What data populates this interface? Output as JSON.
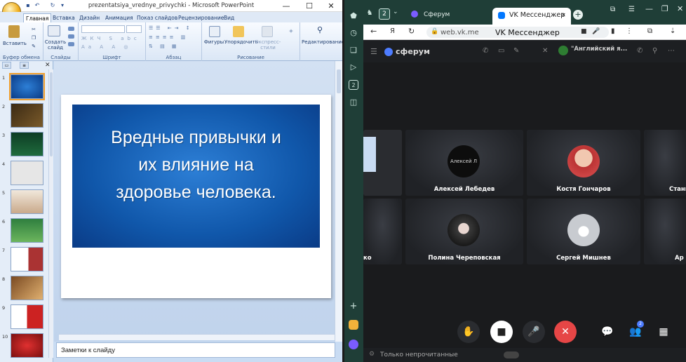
{
  "ppt": {
    "doc_title": "prezentatsiya_vrednye_privychki - Microsoft PowerPoint",
    "tabs": [
      "Главная",
      "Вставка",
      "Дизайн",
      "Анимация",
      "Показ слайдов",
      "Рецензирование",
      "Вид"
    ],
    "ribbon": {
      "paste_label": "Вставить",
      "new_slide_label": "Создать слайд",
      "shapes_label": "Фигуры",
      "arrange_label": "Упорядочить",
      "express_label": "Экспресс-стили",
      "edit_label": "Редактирование",
      "groups": {
        "clipboard": "Буфер обмена",
        "slides": "Слайды",
        "font": "Шрифт",
        "paragraph": "Абзац",
        "drawing": "Рисование"
      }
    },
    "thumbnails": [
      "1",
      "2",
      "3",
      "4",
      "5",
      "6",
      "7",
      "8",
      "9",
      "10"
    ],
    "slide_title": "Вредные привычки и их влияние на здоровье человека.",
    "slide_lines": [
      "Вредные привычки и",
      "их влияние на",
      "здоровье человека."
    ],
    "notes_placeholder": "Заметки к слайду"
  },
  "browser": {
    "tab_count_badge": "2",
    "tabs": [
      {
        "label": "Сферум"
      },
      {
        "label": "VK Мессенджер"
      }
    ],
    "url": "web.vk.me",
    "page_title": "VK Мессенджер",
    "app_name": "сферум",
    "chat_title": "\"Английский я...",
    "participants": [
      {
        "name": "Алексей Лебедев",
        "avatar_text": "Алексей Л"
      },
      {
        "name": "Костя Гончаров"
      },
      {
        "name": "Стани"
      },
      {
        "name": "ко"
      },
      {
        "name": "Полина Череповская"
      },
      {
        "name": "Сергей Мишнев"
      },
      {
        "name": "Ар"
      }
    ],
    "participants_badge": "2",
    "bottom_text": "Только непрочитанные"
  },
  "colors": {
    "ppt_accent": "#1e3d6f",
    "browser_bg": "#1b3b33",
    "end_call": "#e64646"
  }
}
